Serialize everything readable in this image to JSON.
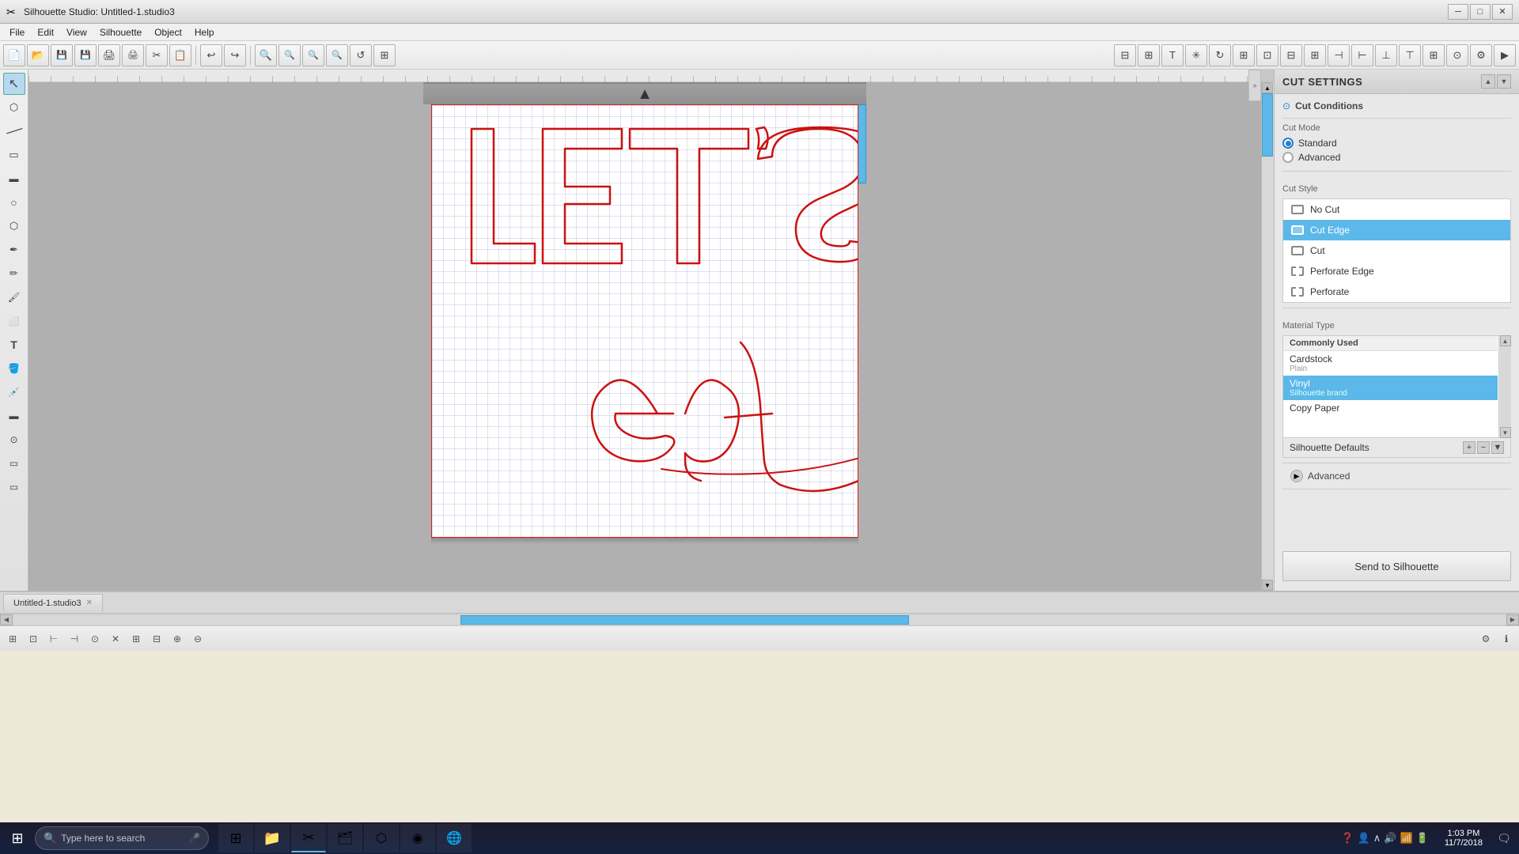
{
  "app": {
    "title": "Silhouette Studio: Untitled-1.studio3",
    "icon": "✂"
  },
  "titlebar": {
    "minimize": "─",
    "maximize": "□",
    "close": "✕"
  },
  "menubar": {
    "items": [
      "File",
      "Edit",
      "View",
      "Silhouette",
      "Object",
      "Help"
    ]
  },
  "toolbar": {
    "buttons": [
      "📄",
      "📂",
      "💾",
      "🖨",
      "✂",
      "📋",
      "↩",
      "↪",
      "🔍",
      "🔍",
      "🔍",
      "🔍",
      "↺",
      "⊞"
    ]
  },
  "tools": {
    "left": [
      {
        "name": "select",
        "icon": "⬡"
      },
      {
        "name": "node-edit",
        "icon": "⬢"
      },
      {
        "name": "line",
        "icon": "╱"
      },
      {
        "name": "rectangle",
        "icon": "▭"
      },
      {
        "name": "rounded-rect",
        "icon": "▬"
      },
      {
        "name": "ellipse",
        "icon": "○"
      },
      {
        "name": "polygon",
        "icon": "⬡"
      },
      {
        "name": "pen",
        "icon": "✒"
      },
      {
        "name": "pencil",
        "icon": "✏"
      },
      {
        "name": "brush",
        "icon": "🖌"
      },
      {
        "name": "eraser",
        "icon": "⬜"
      },
      {
        "name": "text",
        "icon": "T"
      },
      {
        "name": "paint-bucket",
        "icon": "🪣"
      },
      {
        "name": "eyedropper",
        "icon": "💉"
      },
      {
        "name": "crop",
        "icon": "⊡"
      },
      {
        "name": "magic-wand",
        "icon": "⊙"
      },
      {
        "name": "panel1",
        "icon": "▬"
      },
      {
        "name": "panel2",
        "icon": "▭"
      }
    ]
  },
  "canvas": {
    "background": "#b8b8b8"
  },
  "cut_settings": {
    "title": "CUT SETTINGS",
    "cut_conditions_label": "Cut Conditions",
    "cut_mode_label": "Cut Mode",
    "modes": [
      {
        "id": "standard",
        "label": "Standard",
        "selected": true
      },
      {
        "id": "advanced",
        "label": "Advanced",
        "selected": false
      }
    ],
    "cut_style_label": "Cut Style",
    "cut_styles": [
      {
        "id": "no-cut",
        "label": "No Cut",
        "selected": false
      },
      {
        "id": "cut-edge",
        "label": "Cut Edge",
        "selected": true
      },
      {
        "id": "cut",
        "label": "Cut",
        "selected": false
      },
      {
        "id": "perforate-edge",
        "label": "Perforate Edge",
        "selected": false
      },
      {
        "id": "perforate",
        "label": "Perforate",
        "selected": false
      }
    ],
    "material_type_label": "Material Type",
    "material_groups": [
      {
        "group": "Commonly Used",
        "items": [
          {
            "label": "Cardstock",
            "sub": "Plain",
            "selected": false
          },
          {
            "label": "Vinyl",
            "sub": "Silhouette brand",
            "selected": true
          },
          {
            "label": "Copy Paper",
            "sub": "",
            "selected": false
          }
        ]
      }
    ],
    "material_footer_label": "Silhouette Defaults",
    "advanced_label": "Advanced",
    "send_button_label": "Send to Silhouette"
  },
  "tabs": [
    {
      "label": "Untitled-1.studio3",
      "active": true
    }
  ],
  "taskbar": {
    "search_placeholder": "Type here to search",
    "time": "1:03 PM",
    "date": "11/7/2018",
    "apps": [
      {
        "name": "task-manager",
        "icon": "⊞"
      },
      {
        "name": "file-explorer",
        "icon": "📁"
      },
      {
        "name": "silhouette",
        "icon": "✂"
      },
      {
        "name": "excel",
        "icon": "🗂"
      },
      {
        "name": "app5",
        "icon": "⬡"
      },
      {
        "name": "chrome",
        "icon": "◉"
      },
      {
        "name": "browser2",
        "icon": "🌐"
      }
    ]
  }
}
